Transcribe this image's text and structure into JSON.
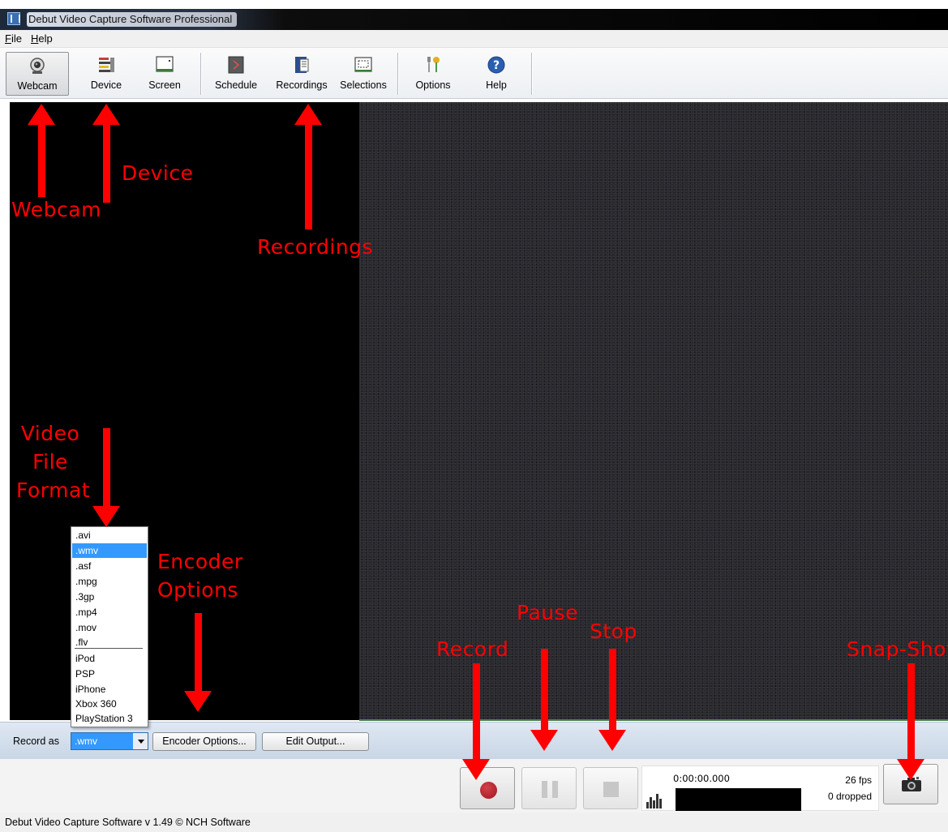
{
  "window": {
    "title": "Debut Video Capture Software Professional"
  },
  "menu": {
    "file": "File",
    "help": "Help"
  },
  "toolbar": {
    "items": [
      {
        "label": "Webcam",
        "icon": "webcam-icon"
      },
      {
        "label": "Device",
        "icon": "device-icon"
      },
      {
        "label": "Screen",
        "icon": "screen-icon"
      },
      {
        "label": "Schedule",
        "icon": "schedule-icon"
      },
      {
        "label": "Recordings",
        "icon": "recordings-icon"
      },
      {
        "label": "Selections",
        "icon": "selections-icon"
      },
      {
        "label": "Options",
        "icon": "options-icon"
      },
      {
        "label": "Help",
        "icon": "help-icon"
      }
    ]
  },
  "record": {
    "label": "Record as",
    "selected_format": ".wmv",
    "encoder_options": "Encoder Options...",
    "edit_output": "Edit Output..."
  },
  "format_options": [
    ".avi",
    ".wmv",
    ".asf",
    ".mpg",
    ".3gp",
    ".mp4",
    ".mov",
    ".flv",
    "iPod",
    "PSP",
    "iPhone",
    "Xbox 360",
    "PlayStation 3"
  ],
  "transport": {
    "time": "0:00:00.000",
    "fps": "26 fps",
    "dropped": "0 dropped"
  },
  "status": {
    "text": "Debut Video Capture Software v 1.49 © NCH Software"
  },
  "annotations": {
    "webcam": "Webcam",
    "device": "Device",
    "recordings": "Recordings",
    "video_file_format": [
      "Video",
      "File",
      "Format"
    ],
    "encoder_options": [
      "Encoder",
      "Options"
    ],
    "pause": "Pause",
    "stop": "Stop",
    "record": "Record",
    "snapshot": "Snap-Shot"
  },
  "colors": {
    "annotation": "#ff0000",
    "selection": "#3399ff",
    "record_dot": "#b5202a"
  }
}
